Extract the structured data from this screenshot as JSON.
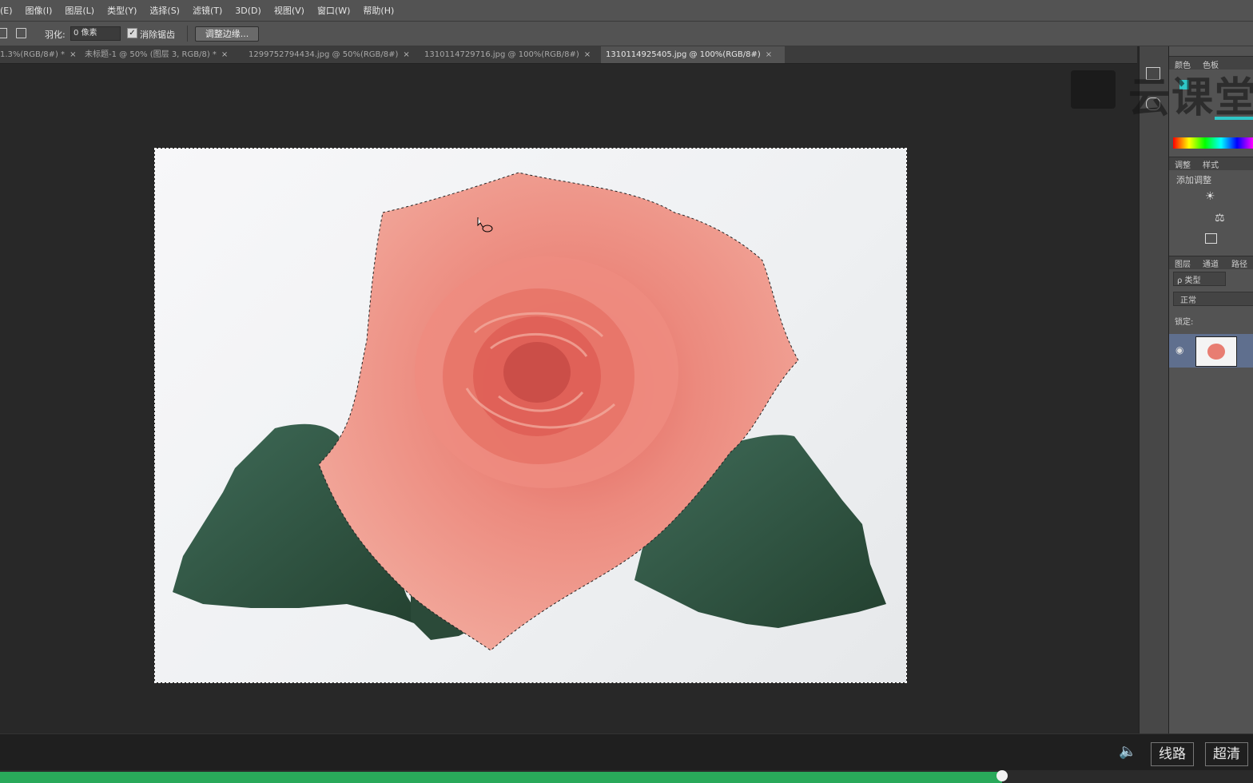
{
  "menu": {
    "items": [
      "(E)",
      "图像(I)",
      "图层(L)",
      "类型(Y)",
      "选择(S)",
      "滤镜(T)",
      "3D(D)",
      "视图(V)",
      "窗口(W)",
      "帮助(H)"
    ]
  },
  "options": {
    "feather_label": "羽化:",
    "feather_value": "0 像素",
    "antialias_label": "消除锯齿",
    "antialias_checked": true,
    "refine_edge_label": "调整边缘..."
  },
  "tabs": [
    {
      "label": "1.3%(RGB/8#) *",
      "close": "×",
      "active": false
    },
    {
      "label": "未标题-1 @ 50% (图层 3, RGB/8) *",
      "close": "×",
      "active": false
    },
    {
      "label": "1299752794434.jpg @ 50%(RGB/8#)",
      "close": "×",
      "active": false
    },
    {
      "label": "1310114729716.jpg @ 100%(RGB/8#)",
      "close": "×",
      "active": false
    },
    {
      "label": "1310114925405.jpg @ 100%(RGB/8#)",
      "close": "×",
      "active": true
    }
  ],
  "panels": {
    "color_tab": "颜色",
    "swatches_tab": "色板",
    "adjust_tab": "调整",
    "styles_tab": "样式",
    "add_adjustment": "添加调整",
    "layers_tab": "图层",
    "channels_tab": "通道",
    "paths_tab": "路径",
    "kind_filter": "ρ 类型",
    "blend_mode": "正常",
    "lock_label": "锁定:"
  },
  "watermark": {
    "text": "云课堂"
  },
  "video": {
    "route_button": "线路",
    "quality_button": "超清",
    "progress": 0.8
  },
  "colors": {
    "accent_green": "#29a95a",
    "ui_panel": "#535353",
    "canvas_bg": "#282828"
  }
}
